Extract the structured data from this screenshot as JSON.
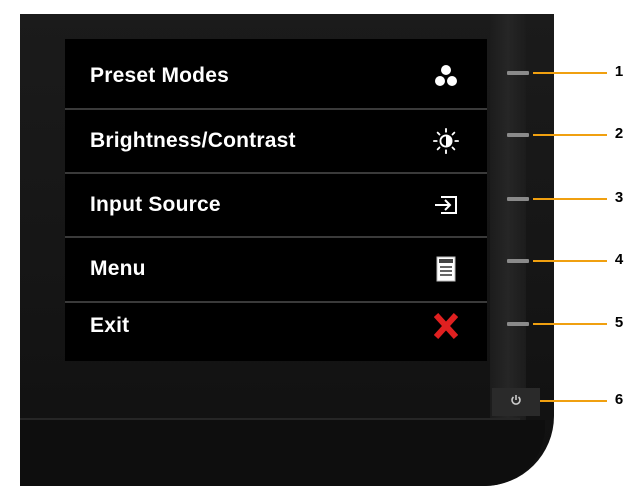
{
  "osd": {
    "items": [
      {
        "label": "Preset Modes",
        "icon": "preset-modes-icon"
      },
      {
        "label": "Brightness/Contrast",
        "icon": "brightness-icon"
      },
      {
        "label": "Input Source",
        "icon": "input-source-icon"
      },
      {
        "label": "Menu",
        "icon": "menu-icon"
      },
      {
        "label": "Exit",
        "icon": "exit-icon"
      }
    ]
  },
  "buttons": {
    "numbers": [
      "1",
      "2",
      "3",
      "4",
      "5",
      "6"
    ],
    "power_icon": "power-icon"
  },
  "colors": {
    "callout": "#f0a010",
    "exit_x": "#e02020",
    "osd_bg": "#000000",
    "bezel": "#1a1a1a"
  }
}
